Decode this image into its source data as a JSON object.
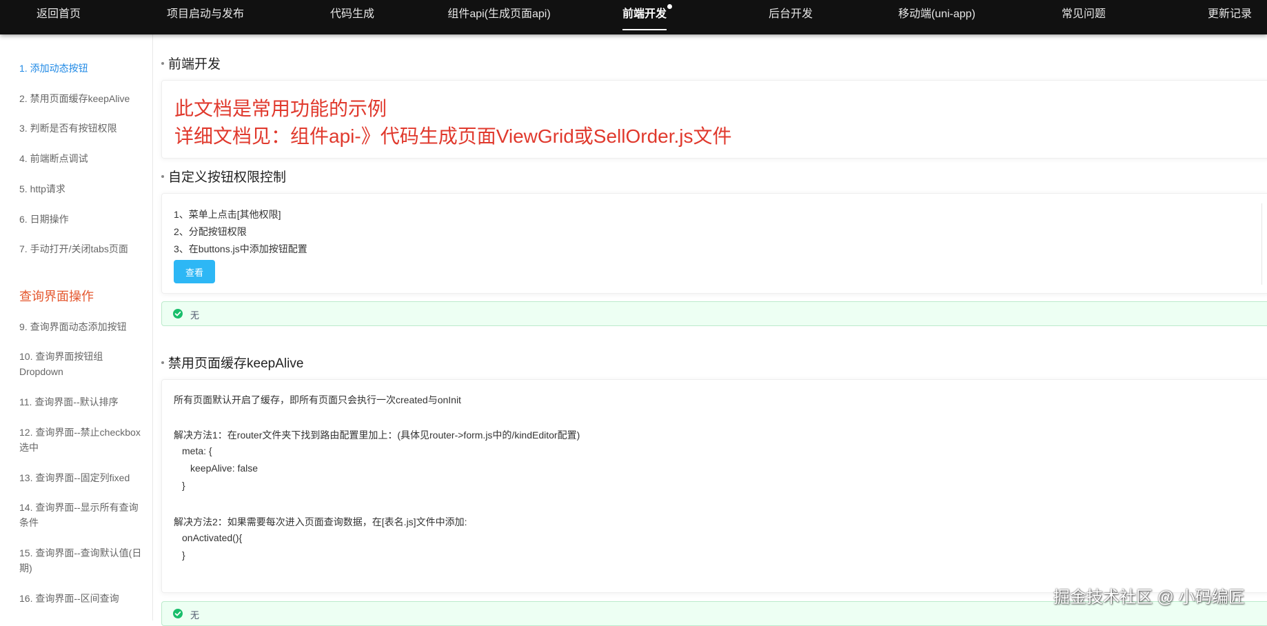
{
  "nav": {
    "items": [
      {
        "label": "返回首页"
      },
      {
        "label": "项目启动与发布"
      },
      {
        "label": "代码生成"
      },
      {
        "label": "组件api(生成页面api)"
      },
      {
        "label": "前端开发"
      },
      {
        "label": "后台开发"
      },
      {
        "label": "移动端(uni-app)"
      },
      {
        "label": "常见问题"
      },
      {
        "label": "更新记录"
      }
    ]
  },
  "sidebar": {
    "items": [
      {
        "label": "1. 添加动态按钮"
      },
      {
        "label": "2. 禁用页面缓存keepAlive"
      },
      {
        "label": "3. 判断是否有按钮权限"
      },
      {
        "label": "4. 前端断点调试"
      },
      {
        "label": "5. http请求"
      },
      {
        "label": "6. 日期操作"
      },
      {
        "label": "7. 手动打开/关闭tabs页面"
      }
    ],
    "group_title": "查询界面操作",
    "group_items": [
      {
        "label": "9. 查询界面动态添加按钮"
      },
      {
        "label": "10. 查询界面按钮组Dropdown"
      },
      {
        "label": "11. 查询界面--默认排序"
      },
      {
        "label": "12. 查询界面--禁止checkbox选中"
      },
      {
        "label": "13. 查询界面--固定列fixed"
      },
      {
        "label": "14. 查询界面--显示所有查询条件"
      },
      {
        "label": "15. 查询界面--查询默认值(日期)"
      },
      {
        "label": "16. 查询界面--区间查询"
      }
    ]
  },
  "main": {
    "section1": {
      "title": "前端开发",
      "line1": "此文档是常用功能的示例",
      "line2": "详细文档见：组件api-》代码生成页面ViewGrid或SellOrder.js文件"
    },
    "section2": {
      "title": "自定义按钮权限控制",
      "steps": [
        "1、菜单上点击[其他权限]",
        "2、分配按钮权限",
        "3、在buttons.js中添加按钮配置"
      ],
      "button_label": "查看",
      "alert_text": "无"
    },
    "section3": {
      "title": "禁用页面缓存keepAlive",
      "lines": [
        "所有页面默认开启了缓存，即所有页面只会执行一次created与onInit",
        "解决方法1：在router文件夹下找到路由配置里加上：(具体见router->form.js中的/kindEditor配置)",
        "meta: {",
        "keepAlive: false",
        "}",
        "解决方法2：如果需要每次进入页面查询数据，在[表名.js]文件中添加:",
        "onActivated(){",
        "}"
      ],
      "alert_text": "无"
    }
  },
  "watermark": "掘金技术社区 @ 小码编匠",
  "colors": {
    "nav_bg": "#111111",
    "sidebar_active": "#1e88e5",
    "group_title": "#e4572e",
    "intro_red": "#e0392d",
    "button_blue": "#2db7f5",
    "success_green": "#19be6b"
  }
}
